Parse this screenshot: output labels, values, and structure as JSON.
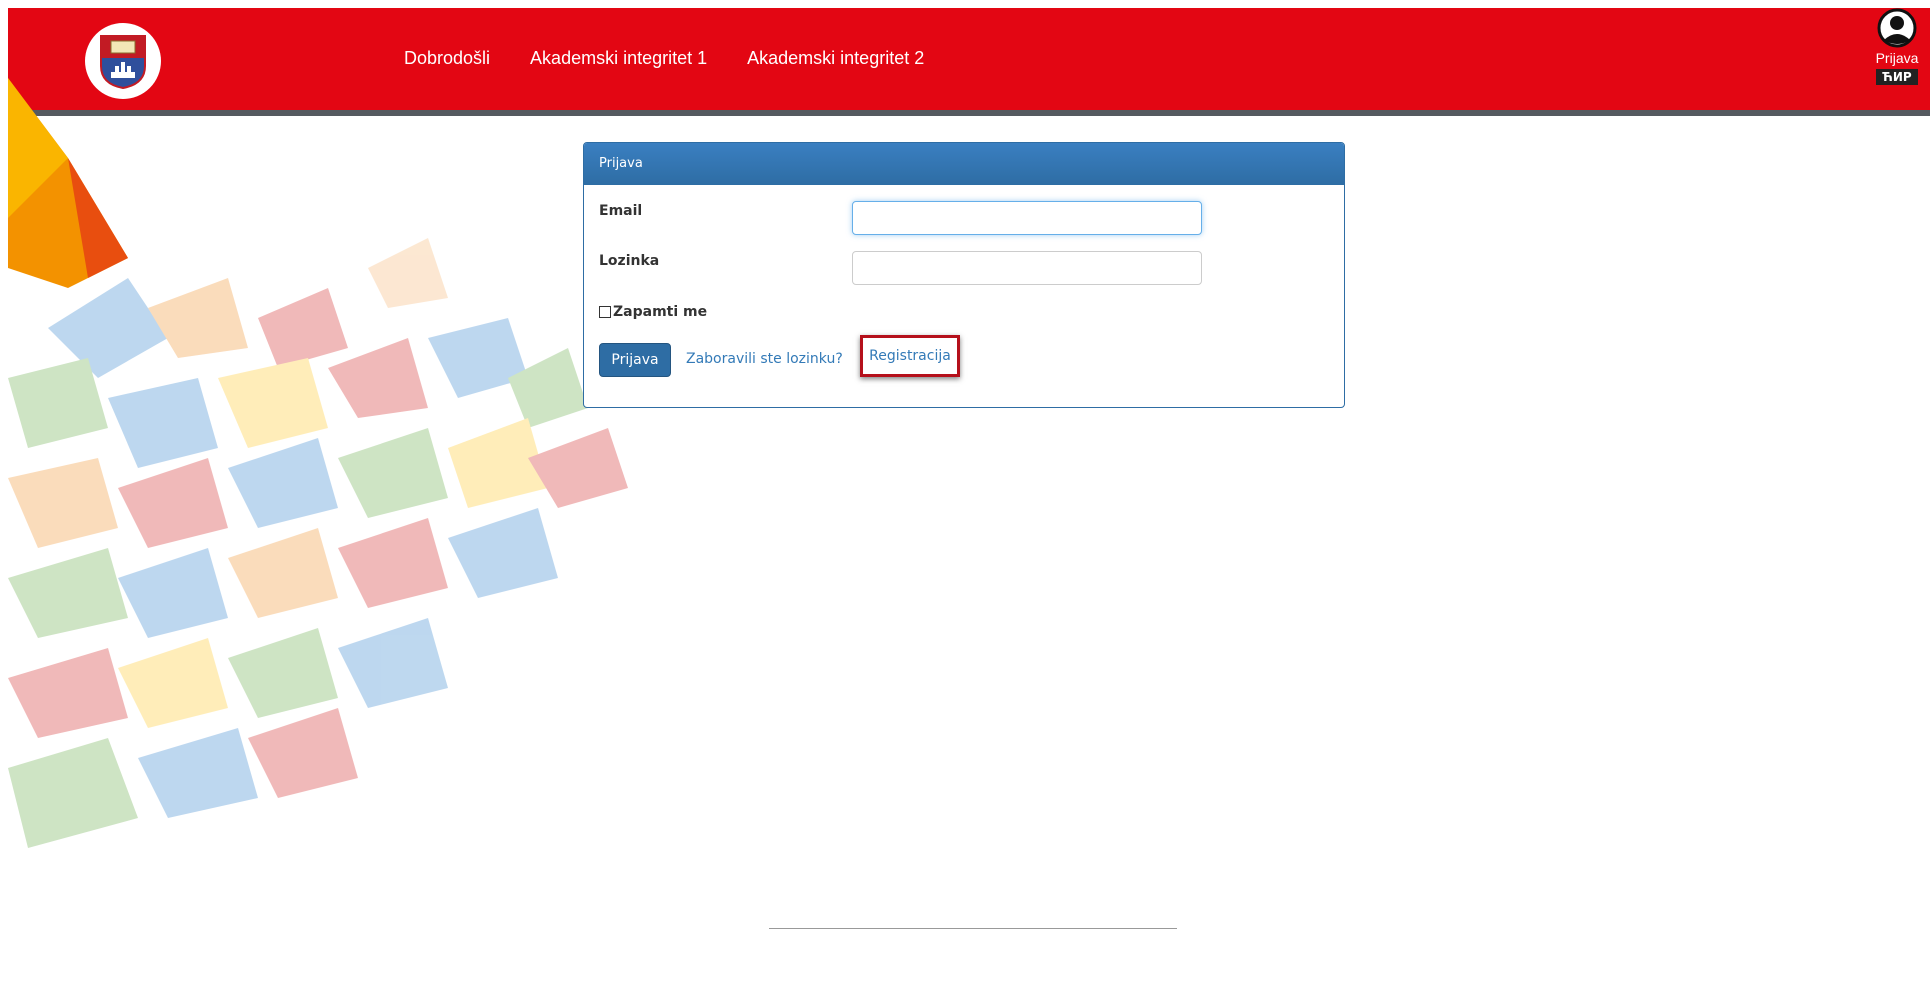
{
  "nav": {
    "items": [
      {
        "label": "Dobrodošli"
      },
      {
        "label": "Akademski integritet 1"
      },
      {
        "label": "Akademski integritet 2"
      }
    ]
  },
  "user": {
    "login_label": "Prijava",
    "language_badge": "ЋИР"
  },
  "login_panel": {
    "title": "Prijava",
    "email_label": "Email",
    "email_value": "",
    "password_label": "Lozinka",
    "password_value": "",
    "remember_label": "Zapamti me",
    "remember_checked": false,
    "submit_label": "Prijava",
    "forgot_link": "Zaboravili ste lozinku?",
    "register_link": "Registracija"
  },
  "colors": {
    "header": "#e30613",
    "header_border": "#555a60",
    "primary": "#2e6da4",
    "highlight": "#b5101b"
  }
}
